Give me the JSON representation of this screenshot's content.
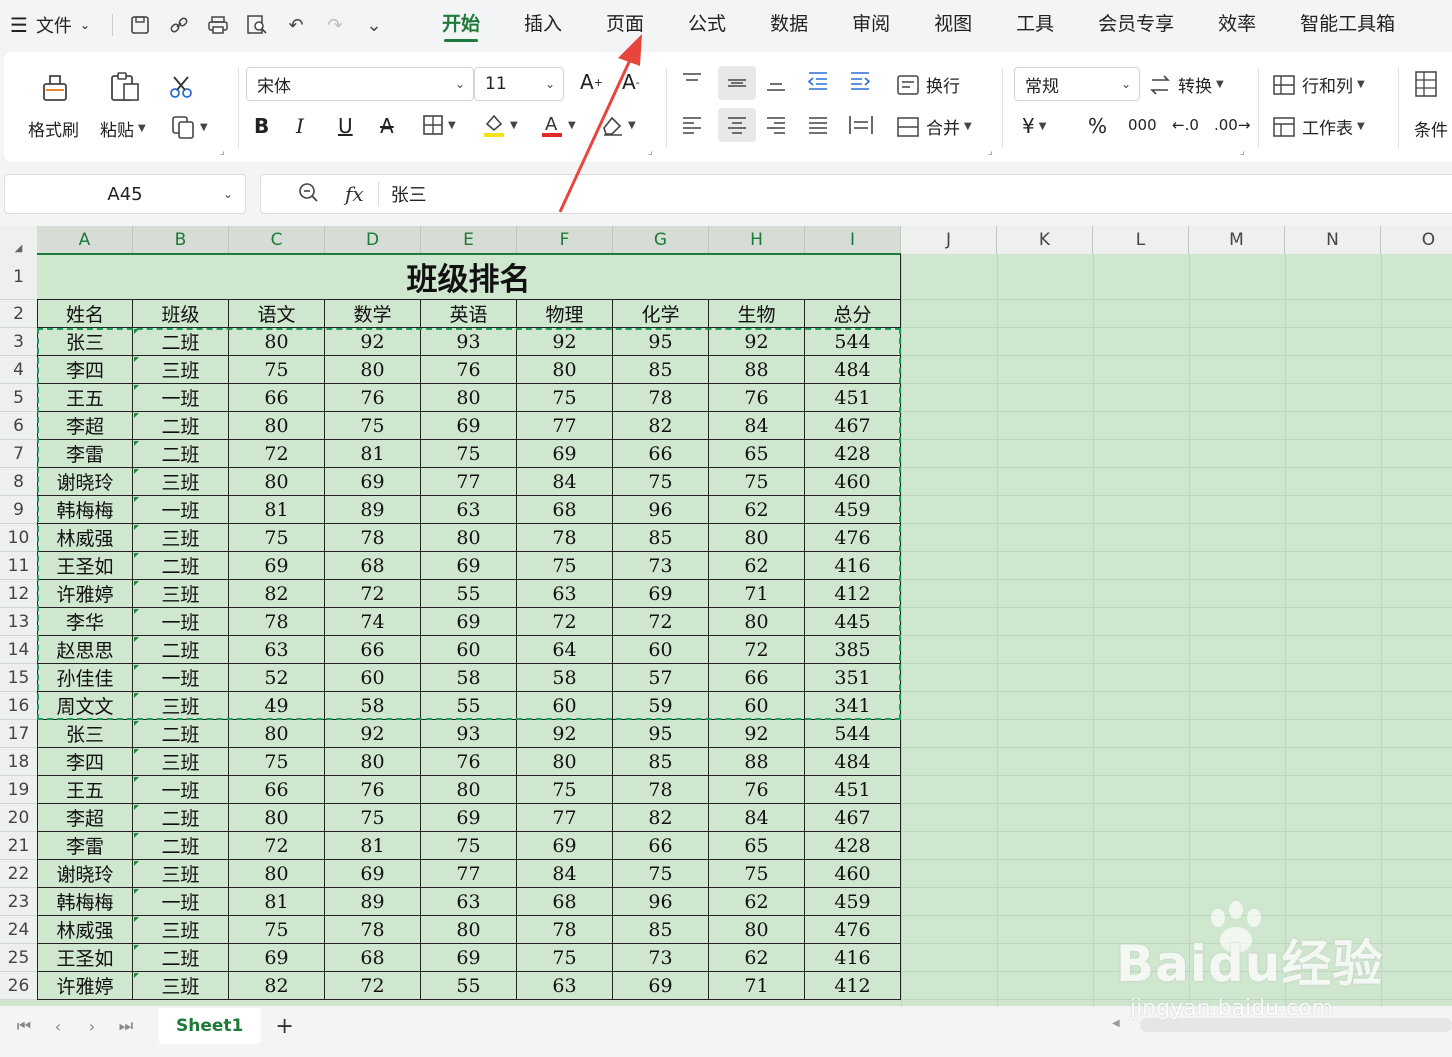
{
  "menubar": {
    "file_label": "文件",
    "tabs": [
      {
        "label": "开始",
        "active": true
      },
      {
        "label": "插入"
      },
      {
        "label": "页面"
      },
      {
        "label": "公式"
      },
      {
        "label": "数据"
      },
      {
        "label": "审阅"
      },
      {
        "label": "视图"
      },
      {
        "label": "工具"
      },
      {
        "label": "会员专享"
      },
      {
        "label": "效率"
      },
      {
        "label": "智能工具箱"
      }
    ]
  },
  "ribbon": {
    "format_painter": "格式刷",
    "paste": "粘贴",
    "font_name": "宋体",
    "font_size": "11",
    "wrap": "换行",
    "merge": "合并",
    "number_format": "常规",
    "convert": "转换",
    "rows_cols": "行和列",
    "worksheet": "工作表",
    "conditional": "条件"
  },
  "formula_bar": {
    "cell_ref": "A45",
    "fx": "fx",
    "value": "张三"
  },
  "columns": [
    "A",
    "B",
    "C",
    "D",
    "E",
    "F",
    "G",
    "H",
    "I",
    "J",
    "K",
    "L",
    "M",
    "N",
    "O"
  ],
  "sheet": {
    "title": "班级排名",
    "headers": [
      "姓名",
      "班级",
      "语文",
      "数学",
      "英语",
      "物理",
      "化学",
      "生物",
      "总分"
    ],
    "rows": [
      [
        "张三",
        "二班",
        "80",
        "92",
        "93",
        "92",
        "95",
        "92",
        "544"
      ],
      [
        "李四",
        "三班",
        "75",
        "80",
        "76",
        "80",
        "85",
        "88",
        "484"
      ],
      [
        "王五",
        "一班",
        "66",
        "76",
        "80",
        "75",
        "78",
        "76",
        "451"
      ],
      [
        "李超",
        "二班",
        "80",
        "75",
        "69",
        "77",
        "82",
        "84",
        "467"
      ],
      [
        "李雷",
        "二班",
        "72",
        "81",
        "75",
        "69",
        "66",
        "65",
        "428"
      ],
      [
        "谢晓玲",
        "三班",
        "80",
        "69",
        "77",
        "84",
        "75",
        "75",
        "460"
      ],
      [
        "韩梅梅",
        "一班",
        "81",
        "89",
        "63",
        "68",
        "96",
        "62",
        "459"
      ],
      [
        "林威强",
        "三班",
        "75",
        "78",
        "80",
        "78",
        "85",
        "80",
        "476"
      ],
      [
        "王圣如",
        "二班",
        "69",
        "68",
        "69",
        "75",
        "73",
        "62",
        "416"
      ],
      [
        "许雅婷",
        "三班",
        "82",
        "72",
        "55",
        "63",
        "69",
        "71",
        "412"
      ],
      [
        "李华",
        "一班",
        "78",
        "74",
        "69",
        "72",
        "72",
        "80",
        "445"
      ],
      [
        "赵思思",
        "二班",
        "63",
        "66",
        "60",
        "64",
        "60",
        "72",
        "385"
      ],
      [
        "孙佳佳",
        "一班",
        "52",
        "60",
        "58",
        "58",
        "57",
        "66",
        "351"
      ],
      [
        "周文文",
        "三班",
        "49",
        "58",
        "55",
        "60",
        "59",
        "60",
        "341"
      ],
      [
        "张三",
        "二班",
        "80",
        "92",
        "93",
        "92",
        "95",
        "92",
        "544"
      ],
      [
        "李四",
        "三班",
        "75",
        "80",
        "76",
        "80",
        "85",
        "88",
        "484"
      ],
      [
        "王五",
        "一班",
        "66",
        "76",
        "80",
        "75",
        "78",
        "76",
        "451"
      ],
      [
        "李超",
        "二班",
        "80",
        "75",
        "69",
        "77",
        "82",
        "84",
        "467"
      ],
      [
        "李雷",
        "二班",
        "72",
        "81",
        "75",
        "69",
        "66",
        "65",
        "428"
      ],
      [
        "谢晓玲",
        "三班",
        "80",
        "69",
        "77",
        "84",
        "75",
        "75",
        "460"
      ],
      [
        "韩梅梅",
        "一班",
        "81",
        "89",
        "63",
        "68",
        "96",
        "62",
        "459"
      ],
      [
        "林威强",
        "三班",
        "75",
        "78",
        "80",
        "78",
        "85",
        "80",
        "476"
      ],
      [
        "王圣如",
        "二班",
        "69",
        "68",
        "69",
        "75",
        "73",
        "62",
        "416"
      ],
      [
        "许雅婷",
        "三班",
        "82",
        "72",
        "55",
        "63",
        "69",
        "71",
        "412"
      ]
    ]
  },
  "sheet_tabs": {
    "active": "Sheet1",
    "add_label": "+"
  },
  "watermark": {
    "main": "Baidu经验",
    "sub": "jingyan.baidu.com"
  },
  "colors": {
    "accent": "#1f7a3a",
    "sheet_bg": "#cfe6cf",
    "marquee": "#1f9b5a",
    "arrow": "#e8453c"
  }
}
